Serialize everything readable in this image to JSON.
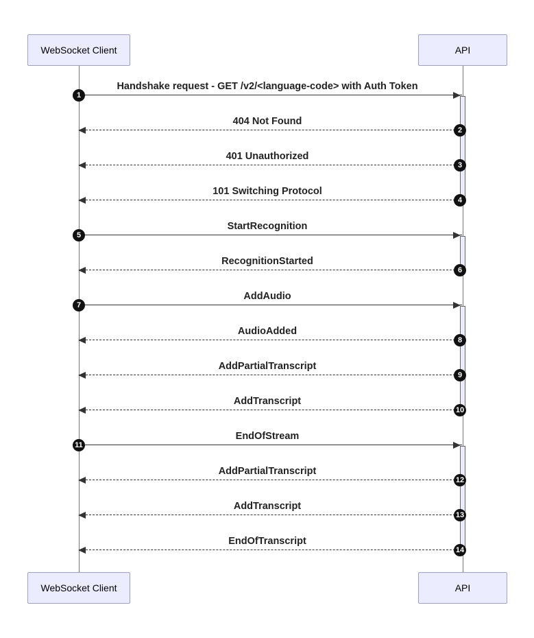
{
  "actors": {
    "left": "WebSocket Client",
    "right": "API"
  },
  "messages": [
    {
      "n": "1",
      "label": "Handshake request - GET /v2/<language-code> with Auth Token",
      "dir": "right",
      "style": "solid"
    },
    {
      "n": "2",
      "label": "404 Not Found",
      "dir": "left",
      "style": "dashed"
    },
    {
      "n": "3",
      "label": "401 Unauthorized",
      "dir": "left",
      "style": "dashed"
    },
    {
      "n": "4",
      "label": "101 Switching Protocol",
      "dir": "left",
      "style": "dashed"
    },
    {
      "n": "5",
      "label": "StartRecognition",
      "dir": "right",
      "style": "solid"
    },
    {
      "n": "6",
      "label": "RecognitionStarted",
      "dir": "left",
      "style": "dashed"
    },
    {
      "n": "7",
      "label": "AddAudio",
      "dir": "right",
      "style": "solid"
    },
    {
      "n": "8",
      "label": "AudioAdded",
      "dir": "left",
      "style": "dashed"
    },
    {
      "n": "9",
      "label": "AddPartialTranscript",
      "dir": "left",
      "style": "dashed"
    },
    {
      "n": "10",
      "label": "AddTranscript",
      "dir": "left",
      "style": "dashed"
    },
    {
      "n": "11",
      "label": "EndOfStream",
      "dir": "right",
      "style": "solid"
    },
    {
      "n": "12",
      "label": "AddPartialTranscript",
      "dir": "left",
      "style": "dashed"
    },
    {
      "n": "13",
      "label": "AddTranscript",
      "dir": "left",
      "style": "dashed"
    },
    {
      "n": "14",
      "label": "EndOfTranscript",
      "dir": "left",
      "style": "dashed"
    }
  ],
  "activation_groups": [
    {
      "start": 1,
      "end": 4
    },
    {
      "start": 5,
      "end": 6
    },
    {
      "start": 7,
      "end": 10
    },
    {
      "start": 11,
      "end": 14
    }
  ]
}
